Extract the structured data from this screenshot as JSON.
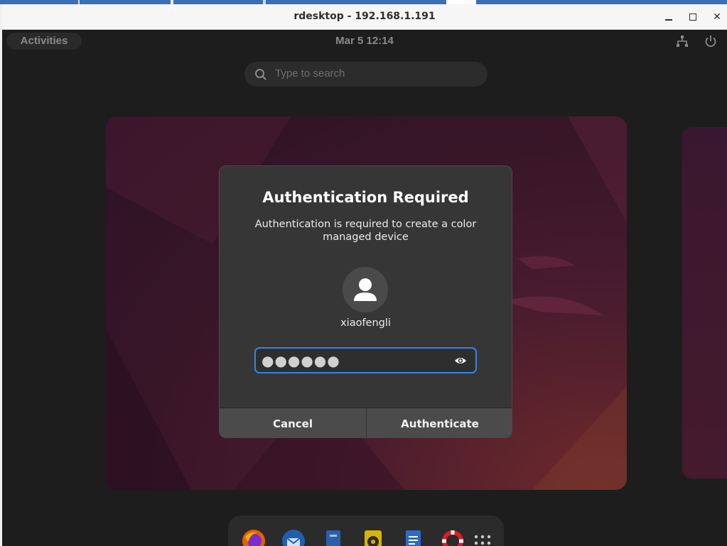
{
  "window": {
    "title": "rdesktop - 192.168.1.191",
    "minimize_icon": "minimize-icon",
    "maximize_icon": "maximize-icon",
    "close_icon": "close-icon",
    "close_glyph": "✕"
  },
  "topbar": {
    "activities_label": "Activities",
    "clock": "Mar 5  12:14",
    "network_icon": "network-icon",
    "power_icon": "power-icon"
  },
  "search": {
    "placeholder": "Type to search"
  },
  "dialog": {
    "title": "Authentication Required",
    "message": "Authentication is required to create a color managed device",
    "avatar_icon": "user-avatar-icon",
    "username": "xiaofengli",
    "password_value": "●●●●●●",
    "reveal_icon": "eye-icon",
    "cancel_label": "Cancel",
    "authenticate_label": "Authenticate",
    "accent_color": "#3584e4"
  },
  "dock": {
    "items": [
      "firefox-icon",
      "thunderbird-icon",
      "files-icon",
      "rhythmbox-icon",
      "libreoffice-writer-icon",
      "help-icon",
      "app-grid-icon"
    ]
  }
}
